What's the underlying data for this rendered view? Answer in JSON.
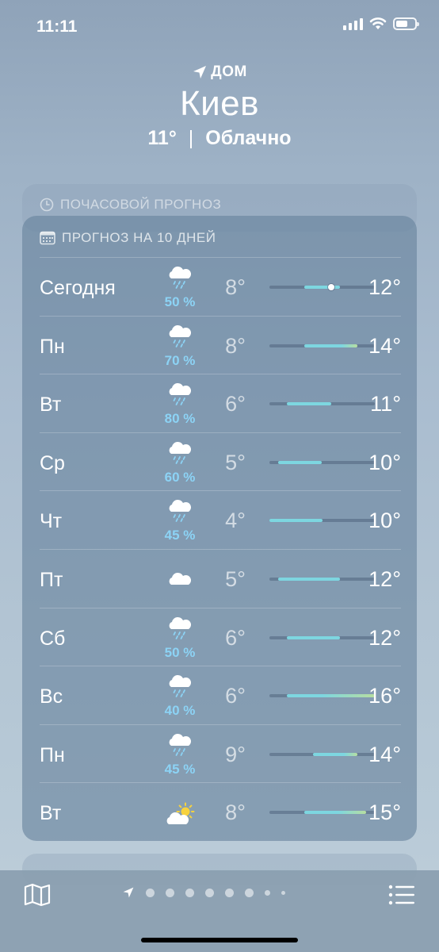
{
  "status_bar": {
    "time": "11:11",
    "battery_level_percent": 60
  },
  "header": {
    "location_label": "ДОМ",
    "city": "Киев",
    "temperature": "11°",
    "separator": "|",
    "condition": "Облачно"
  },
  "hourly": {
    "title": "ПОЧАСОВОЙ ПРОГНОЗ"
  },
  "forecast": {
    "title": "ПРОГНОЗ НА 10 ДНЕЙ",
    "range": [
      4,
      16
    ],
    "days": [
      {
        "day": "Сегодня",
        "icon": "cloud-rain-icon",
        "precip": "50 %",
        "low": "8°",
        "high": "12°",
        "low_v": 8,
        "high_v": 12,
        "current_v": 11
      },
      {
        "day": "Пн",
        "icon": "cloud-rain-icon",
        "precip": "70 %",
        "low": "8°",
        "high": "14°",
        "low_v": 8,
        "high_v": 14
      },
      {
        "day": "Вт",
        "icon": "cloud-rain-icon",
        "precip": "80 %",
        "low": "6°",
        "high": "11°",
        "low_v": 6,
        "high_v": 11
      },
      {
        "day": "Ср",
        "icon": "cloud-rain-icon",
        "precip": "60 %",
        "low": "5°",
        "high": "10°",
        "low_v": 5,
        "high_v": 10
      },
      {
        "day": "Чт",
        "icon": "cloud-rain-icon",
        "precip": "45 %",
        "low": "4°",
        "high": "10°",
        "low_v": 4,
        "high_v": 10
      },
      {
        "day": "Пт",
        "icon": "cloud-icon",
        "precip": "",
        "low": "5°",
        "high": "12°",
        "low_v": 5,
        "high_v": 12
      },
      {
        "day": "Сб",
        "icon": "cloud-rain-icon",
        "precip": "50 %",
        "low": "6°",
        "high": "12°",
        "low_v": 6,
        "high_v": 12
      },
      {
        "day": "Вс",
        "icon": "cloud-rain-icon",
        "precip": "40 %",
        "low": "6°",
        "high": "16°",
        "low_v": 6,
        "high_v": 16
      },
      {
        "day": "Пн",
        "icon": "cloud-rain-icon",
        "precip": "45 %",
        "low": "9°",
        "high": "14°",
        "low_v": 9,
        "high_v": 14
      },
      {
        "day": "Вт",
        "icon": "partly-sunny-icon",
        "precip": "",
        "low": "8°",
        "high": "15°",
        "low_v": 8,
        "high_v": 15
      }
    ]
  },
  "tab_bar": {
    "map": "map-icon",
    "list": "list-icon",
    "page_count": 9,
    "current_page": 0
  },
  "colors": {
    "cool": "#7dd6e0",
    "warm": "#b7dea0",
    "precip": "#8cd3f5"
  }
}
